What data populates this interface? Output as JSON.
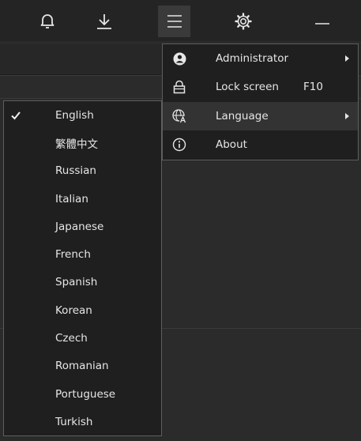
{
  "toolbar": {
    "icons": [
      "bell-icon",
      "download-icon",
      "hamburger-menu-icon",
      "gear-icon",
      "minimize-icon"
    ]
  },
  "main_menu": {
    "items": [
      {
        "icon": "user-circle-icon",
        "label": "Administrator",
        "shortcut": "",
        "has_submenu": true
      },
      {
        "icon": "lock-icon",
        "label": "Lock screen",
        "shortcut": "F10",
        "has_submenu": false
      },
      {
        "icon": "globe-language-icon",
        "label": "Language",
        "shortcut": "",
        "has_submenu": true,
        "highlighted": true
      },
      {
        "icon": "info-icon",
        "label": "About",
        "shortcut": "",
        "has_submenu": false
      }
    ]
  },
  "language_menu": {
    "selected": "English",
    "items": [
      {
        "label": "English",
        "checked": true
      },
      {
        "label": "繁體中文",
        "checked": false
      },
      {
        "label": "Russian",
        "checked": false
      },
      {
        "label": "Italian",
        "checked": false
      },
      {
        "label": "Japanese",
        "checked": false
      },
      {
        "label": "French",
        "checked": false
      },
      {
        "label": "Spanish",
        "checked": false
      },
      {
        "label": "Korean",
        "checked": false
      },
      {
        "label": "Czech",
        "checked": false
      },
      {
        "label": "Romanian",
        "checked": false
      },
      {
        "label": "Portuguese",
        "checked": false
      },
      {
        "label": "Turkish",
        "checked": false
      }
    ]
  },
  "colors": {
    "background": "#2b2b2b",
    "topbar": "#242424",
    "menu_bg": "#1f1f1f",
    "menu_border": "#5e5e5e",
    "highlight": "#333333",
    "text": "#e6e6e6"
  }
}
